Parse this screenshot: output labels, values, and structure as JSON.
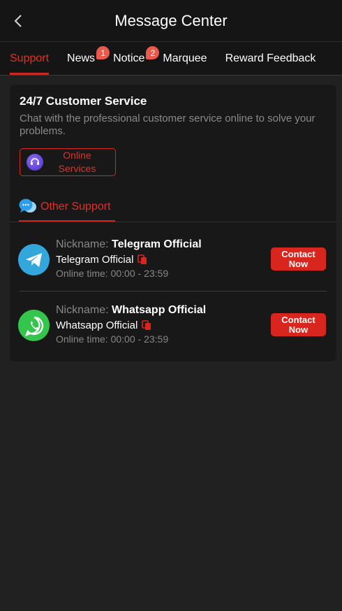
{
  "header": {
    "title": "Message Center"
  },
  "tabs": [
    {
      "label": "Support",
      "active": true,
      "badge": null
    },
    {
      "label": "News",
      "active": false,
      "badge": "1"
    },
    {
      "label": "Notice",
      "active": false,
      "badge": "2"
    },
    {
      "label": "Marquee",
      "active": false,
      "badge": null
    },
    {
      "label": "Reward Feedback",
      "active": false,
      "badge": null
    }
  ],
  "customer_service": {
    "title": "24/7 Customer Service",
    "description": "Chat with the professional customer service online to solve your problems.",
    "online_button_label": "Online Services"
  },
  "other_support": {
    "label": "Other Support",
    "nickname_prefix": "Nickname:",
    "online_time_prefix": "Online time:",
    "contacts": [
      {
        "icon": "telegram-icon",
        "nickname": "Telegram Official",
        "name": "Telegram Official",
        "online_time": "00:00 - 23:59",
        "button_label": "Contact Now"
      },
      {
        "icon": "whatsapp-icon",
        "nickname": "Whatsapp Official",
        "name": "Whatsapp Official",
        "online_time": "00:00 - 23:59",
        "button_label": "Contact Now"
      }
    ]
  },
  "colors": {
    "accent": "#d8261e",
    "background": "#212121",
    "card": "#181818",
    "badge": "#ea5a4c"
  }
}
